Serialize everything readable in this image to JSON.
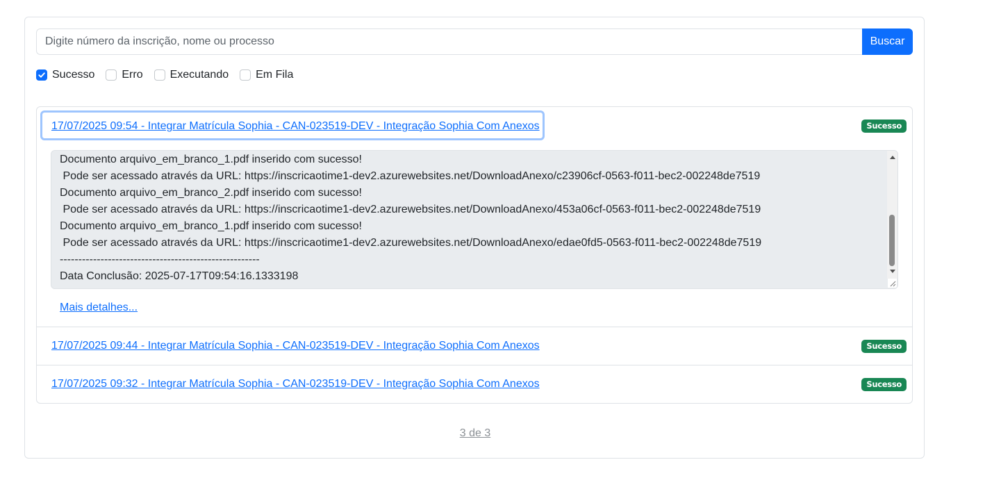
{
  "search": {
    "placeholder": "Digite número da inscrição, nome ou processo",
    "button_label": "Buscar"
  },
  "filters": [
    {
      "label": "Sucesso",
      "checked": true
    },
    {
      "label": "Erro",
      "checked": false
    },
    {
      "label": "Executando",
      "checked": false
    },
    {
      "label": "Em Fila",
      "checked": false
    }
  ],
  "items": [
    {
      "title": "17/07/2025 09:54 - Integrar Matrícula Sophia - CAN-023519-DEV - Integração Sophia Com Anexos",
      "status": "Sucesso",
      "expanded": true,
      "log_lines": [
        "Documento arquivo_em_branco_1.pdf inserido com sucesso!",
        " Pode ser acessado através da URL: https://inscricaotime1-dev2.azurewebsites.net/DownloadAnexo/c23906cf-0563-f011-bec2-002248de7519",
        "Documento arquivo_em_branco_2.pdf inserido com sucesso!",
        " Pode ser acessado através da URL: https://inscricaotime1-dev2.azurewebsites.net/DownloadAnexo/453a06cf-0563-f011-bec2-002248de7519",
        "Documento arquivo_em_branco_1.pdf inserido com sucesso!",
        " Pode ser acessado através da URL: https://inscricaotime1-dev2.azurewebsites.net/DownloadAnexo/edae0fd5-0563-f011-bec2-002248de7519",
        "------------------------------------------------------",
        "Data Conclusão: 2025-07-17T09:54:16.1333198"
      ],
      "more_details": "Mais detalhes..."
    },
    {
      "title": "17/07/2025 09:44 - Integrar Matrícula Sophia - CAN-023519-DEV - Integração Sophia Com Anexos",
      "status": "Sucesso",
      "expanded": false
    },
    {
      "title": "17/07/2025 09:32 - Integrar Matrícula Sophia - CAN-023519-DEV - Integração Sophia Com Anexos",
      "status": "Sucesso",
      "expanded": false
    }
  ],
  "pagination": {
    "label": "3 de 3"
  },
  "colors": {
    "primary": "#0d6efd",
    "success": "#198754",
    "log_background": "#e9ecef",
    "border": "#dee2e6"
  }
}
